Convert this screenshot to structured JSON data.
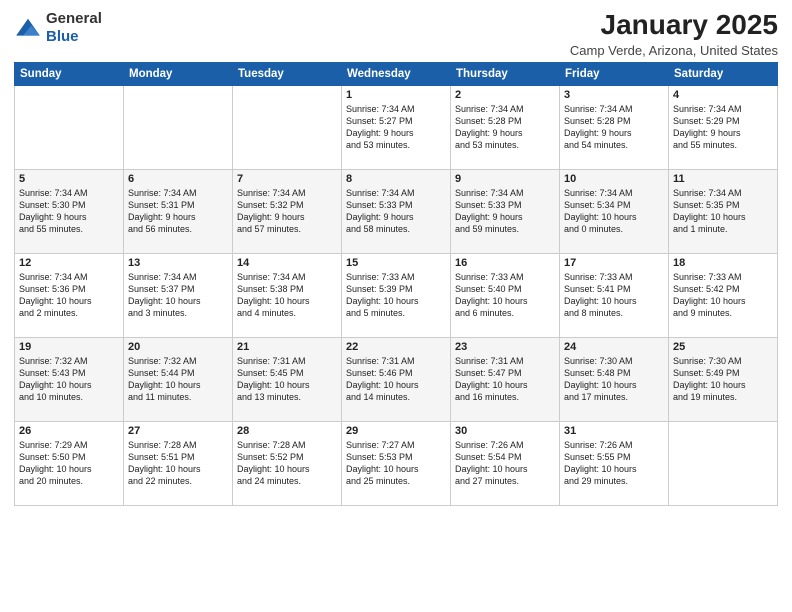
{
  "header": {
    "logo_general": "General",
    "logo_blue": "Blue",
    "month": "January 2025",
    "location": "Camp Verde, Arizona, United States"
  },
  "weekdays": [
    "Sunday",
    "Monday",
    "Tuesday",
    "Wednesday",
    "Thursday",
    "Friday",
    "Saturday"
  ],
  "weeks": [
    [
      {
        "day": "",
        "info": ""
      },
      {
        "day": "",
        "info": ""
      },
      {
        "day": "",
        "info": ""
      },
      {
        "day": "1",
        "info": "Sunrise: 7:34 AM\nSunset: 5:27 PM\nDaylight: 9 hours\nand 53 minutes."
      },
      {
        "day": "2",
        "info": "Sunrise: 7:34 AM\nSunset: 5:28 PM\nDaylight: 9 hours\nand 53 minutes."
      },
      {
        "day": "3",
        "info": "Sunrise: 7:34 AM\nSunset: 5:28 PM\nDaylight: 9 hours\nand 54 minutes."
      },
      {
        "day": "4",
        "info": "Sunrise: 7:34 AM\nSunset: 5:29 PM\nDaylight: 9 hours\nand 55 minutes."
      }
    ],
    [
      {
        "day": "5",
        "info": "Sunrise: 7:34 AM\nSunset: 5:30 PM\nDaylight: 9 hours\nand 55 minutes."
      },
      {
        "day": "6",
        "info": "Sunrise: 7:34 AM\nSunset: 5:31 PM\nDaylight: 9 hours\nand 56 minutes."
      },
      {
        "day": "7",
        "info": "Sunrise: 7:34 AM\nSunset: 5:32 PM\nDaylight: 9 hours\nand 57 minutes."
      },
      {
        "day": "8",
        "info": "Sunrise: 7:34 AM\nSunset: 5:33 PM\nDaylight: 9 hours\nand 58 minutes."
      },
      {
        "day": "9",
        "info": "Sunrise: 7:34 AM\nSunset: 5:33 PM\nDaylight: 9 hours\nand 59 minutes."
      },
      {
        "day": "10",
        "info": "Sunrise: 7:34 AM\nSunset: 5:34 PM\nDaylight: 10 hours\nand 0 minutes."
      },
      {
        "day": "11",
        "info": "Sunrise: 7:34 AM\nSunset: 5:35 PM\nDaylight: 10 hours\nand 1 minute."
      }
    ],
    [
      {
        "day": "12",
        "info": "Sunrise: 7:34 AM\nSunset: 5:36 PM\nDaylight: 10 hours\nand 2 minutes."
      },
      {
        "day": "13",
        "info": "Sunrise: 7:34 AM\nSunset: 5:37 PM\nDaylight: 10 hours\nand 3 minutes."
      },
      {
        "day": "14",
        "info": "Sunrise: 7:34 AM\nSunset: 5:38 PM\nDaylight: 10 hours\nand 4 minutes."
      },
      {
        "day": "15",
        "info": "Sunrise: 7:33 AM\nSunset: 5:39 PM\nDaylight: 10 hours\nand 5 minutes."
      },
      {
        "day": "16",
        "info": "Sunrise: 7:33 AM\nSunset: 5:40 PM\nDaylight: 10 hours\nand 6 minutes."
      },
      {
        "day": "17",
        "info": "Sunrise: 7:33 AM\nSunset: 5:41 PM\nDaylight: 10 hours\nand 8 minutes."
      },
      {
        "day": "18",
        "info": "Sunrise: 7:33 AM\nSunset: 5:42 PM\nDaylight: 10 hours\nand 9 minutes."
      }
    ],
    [
      {
        "day": "19",
        "info": "Sunrise: 7:32 AM\nSunset: 5:43 PM\nDaylight: 10 hours\nand 10 minutes."
      },
      {
        "day": "20",
        "info": "Sunrise: 7:32 AM\nSunset: 5:44 PM\nDaylight: 10 hours\nand 11 minutes."
      },
      {
        "day": "21",
        "info": "Sunrise: 7:31 AM\nSunset: 5:45 PM\nDaylight: 10 hours\nand 13 minutes."
      },
      {
        "day": "22",
        "info": "Sunrise: 7:31 AM\nSunset: 5:46 PM\nDaylight: 10 hours\nand 14 minutes."
      },
      {
        "day": "23",
        "info": "Sunrise: 7:31 AM\nSunset: 5:47 PM\nDaylight: 10 hours\nand 16 minutes."
      },
      {
        "day": "24",
        "info": "Sunrise: 7:30 AM\nSunset: 5:48 PM\nDaylight: 10 hours\nand 17 minutes."
      },
      {
        "day": "25",
        "info": "Sunrise: 7:30 AM\nSunset: 5:49 PM\nDaylight: 10 hours\nand 19 minutes."
      }
    ],
    [
      {
        "day": "26",
        "info": "Sunrise: 7:29 AM\nSunset: 5:50 PM\nDaylight: 10 hours\nand 20 minutes."
      },
      {
        "day": "27",
        "info": "Sunrise: 7:28 AM\nSunset: 5:51 PM\nDaylight: 10 hours\nand 22 minutes."
      },
      {
        "day": "28",
        "info": "Sunrise: 7:28 AM\nSunset: 5:52 PM\nDaylight: 10 hours\nand 24 minutes."
      },
      {
        "day": "29",
        "info": "Sunrise: 7:27 AM\nSunset: 5:53 PM\nDaylight: 10 hours\nand 25 minutes."
      },
      {
        "day": "30",
        "info": "Sunrise: 7:26 AM\nSunset: 5:54 PM\nDaylight: 10 hours\nand 27 minutes."
      },
      {
        "day": "31",
        "info": "Sunrise: 7:26 AM\nSunset: 5:55 PM\nDaylight: 10 hours\nand 29 minutes."
      },
      {
        "day": "",
        "info": ""
      }
    ]
  ]
}
